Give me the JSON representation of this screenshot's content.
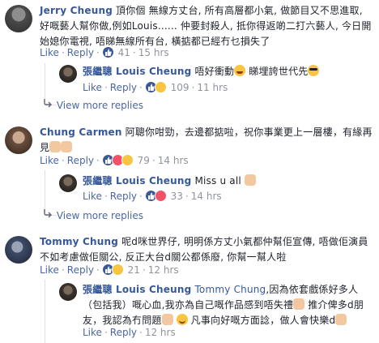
{
  "comments": [
    {
      "name": "Jerry Cheung",
      "body": "頂你個 無線方丈台, 所有高層都小氣, 做節目又不思進取, 好嘅藝人幫你做,例如Louis...... 仲要封殺人, 抵你得返啲二打六藝人, 今日開始媳你電視, 唔睇無線所有台, 橫掂都已經冇乜損失了",
      "like": "Like",
      "reply": "Reply",
      "count": "41",
      "time": "15 hrs",
      "reply_item": {
        "name": "張繼聰 Louis Cheung",
        "body_before": "唔好衝動",
        "body_mid": "睇埋誇世代先",
        "like": "Like",
        "reply": "Reply",
        "count": "109",
        "time": "11 hrs"
      },
      "view_more": "View more replies"
    },
    {
      "name": "Chung Carmen",
      "body": "阿聰你咁勁，去邊都掂啦，祝你事業更上一層樓，有緣再見",
      "like": "Like",
      "reply": "Reply",
      "count": "79",
      "time": "14 hrs",
      "reply_item": {
        "name": "張繼聰 Louis Cheung",
        "body_before": "Miss u all",
        "like": "Like",
        "reply": "Reply",
        "count": "33",
        "time": "14 hrs"
      },
      "view_more": "View more replies"
    },
    {
      "name": "Tommy Chung",
      "body": "呢d咪世界仔, 明明係方丈小氣都仲幫佢宣傳, 唔做佢演員不如考慮做佢關公, 反正大台d關公都係廢, 你幫一幫人啦",
      "like": "Like",
      "reply": "Reply",
      "count": "21",
      "time": "12 hrs",
      "reply_item": {
        "name": "張繼聰 Louis Cheung",
        "mention": "Tommy Chung",
        "body_1": ",因為依套戲係好多人（包括我）嘅心血,我亦為自己嘅作品感到唔失禮",
        "body_2": "推介俾多d朋友，我認為冇問題",
        "body_3": "凡事向好嘅方面諗，做人會快樂d",
        "like": "Like",
        "reply": "Reply",
        "time": "12 hrs"
      }
    }
  ],
  "colors": {
    "link": "#365899",
    "meta": "#90949c",
    "action": "#4b67a1",
    "like": "#3b5998",
    "haha": "#f7c542",
    "love": "#f25268"
  },
  "icons": [
    "thumbs-up-icon",
    "haha-icon",
    "love-icon",
    "reply-arrow-icon",
    "sunglasses-emoji",
    "laugh-emoji",
    "clap-emoji",
    "pray-emoji",
    "smile-emoji",
    "thumbs-up-emoji"
  ]
}
